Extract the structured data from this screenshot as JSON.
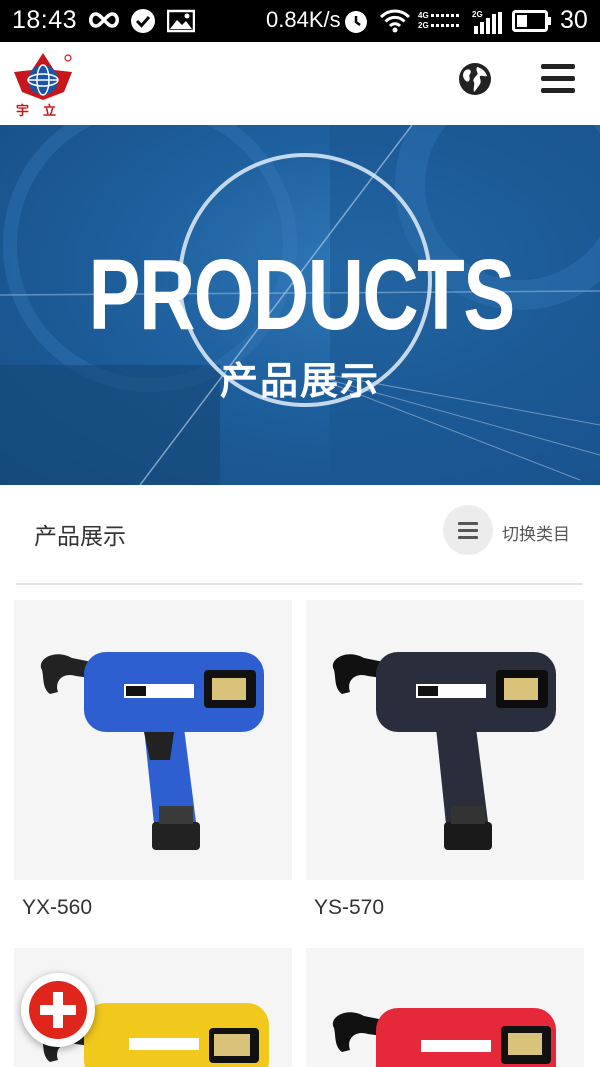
{
  "status_bar": {
    "time": "18:43",
    "speed": "0.84K/s",
    "battery": "30",
    "net_4g": "4G",
    "net_2g": "2G",
    "net_2g_b": "2G"
  },
  "header": {
    "logo_text": "宇立",
    "logo_icon": "yuli-logo-icon",
    "globe_icon": "globe-icon",
    "menu_icon": "hamburger-menu-icon"
  },
  "banner": {
    "title": "PRODUCTS",
    "subtitle": "产品展示"
  },
  "section": {
    "title": "产品展示",
    "switch_label": "切换类目"
  },
  "products": [
    {
      "name": "YX-560",
      "color": "#2e5fd0"
    },
    {
      "name": "YS-570",
      "color": "#2a2e3c"
    },
    {
      "name": "",
      "color": "#f1c81c"
    },
    {
      "name": "",
      "color": "#e5283a"
    }
  ],
  "fab": {
    "icon": "add-plus-icon"
  }
}
